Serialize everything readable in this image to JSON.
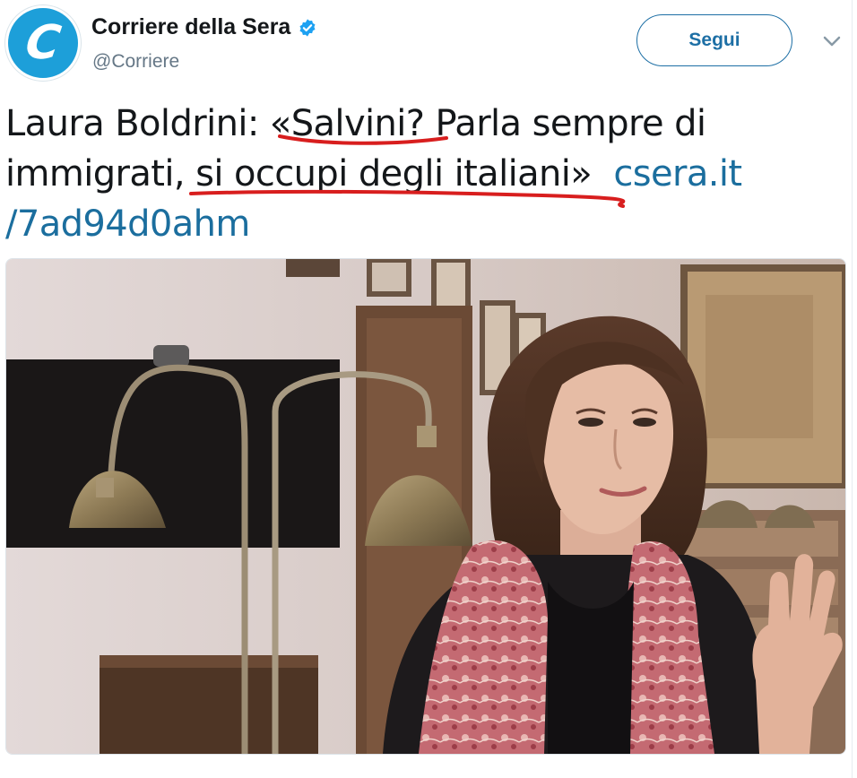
{
  "account": {
    "display_name": "Corriere della Sera",
    "handle": "@Corriere",
    "avatar_letter": "C",
    "verified": true
  },
  "follow_button": {
    "label": "Segui"
  },
  "menu": {
    "icon": "chevron-down-icon"
  },
  "tweet": {
    "text_line1_a": "Laura Boldrini: «",
    "text_line1_b": "Salvini?",
    "text_line1_c": " Parla sempre di",
    "text_line2_a": "immigrati, ",
    "text_line2_b": "si occupi degli italiani»",
    "link_part1": "csera.it",
    "link_part2": "/7ad94d0ahm"
  },
  "media": {
    "type": "photo"
  },
  "colors": {
    "brand_blue": "#1d9fd9",
    "link_blue": "#1b6e9e",
    "underline_red": "#d81e1e"
  }
}
